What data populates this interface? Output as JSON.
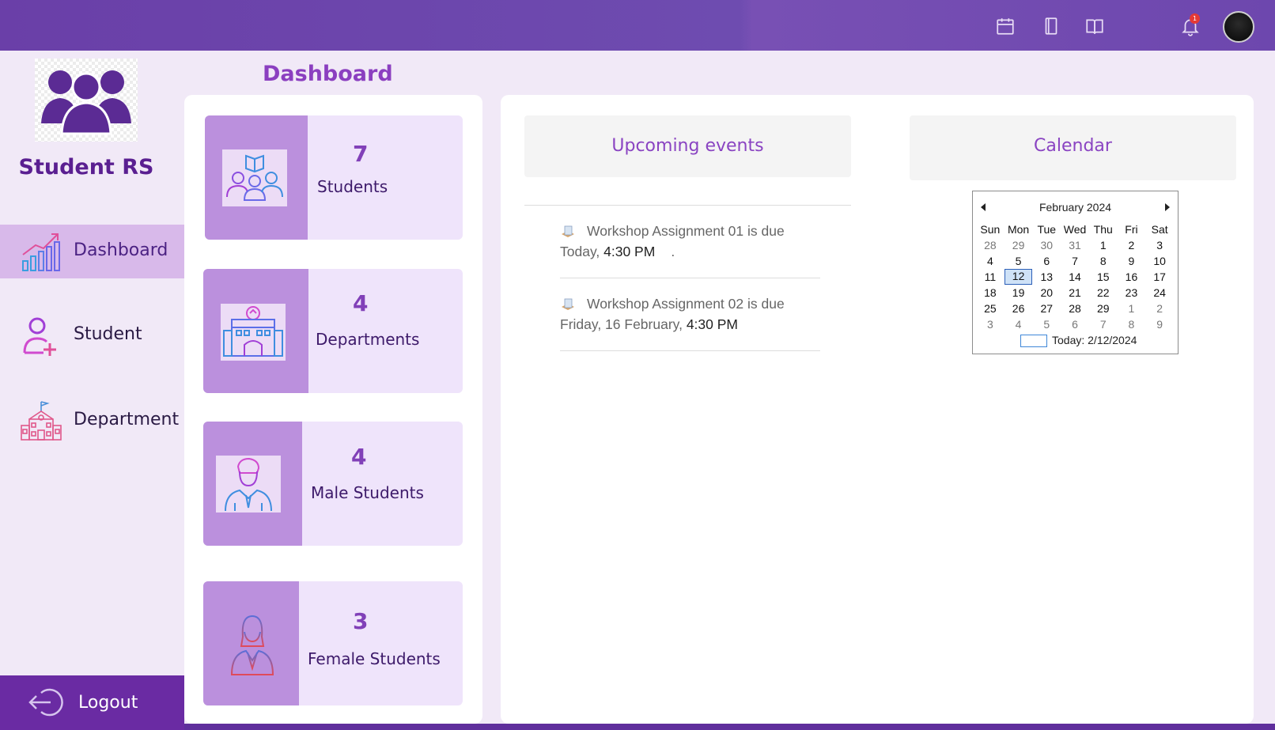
{
  "app": {
    "brand": "Student RS",
    "notification_count": "1"
  },
  "sidebar": {
    "items": [
      {
        "label": "Dashboard",
        "icon": "bar-chart-icon",
        "active": true
      },
      {
        "label": "Student",
        "icon": "add-user-icon",
        "active": false
      },
      {
        "label": "Department",
        "icon": "school-building-icon",
        "active": false
      }
    ],
    "logout_label": "Logout"
  },
  "page": {
    "title": "Dashboard"
  },
  "stats": [
    {
      "value": "7",
      "label": "Students",
      "icon": "students-reading-icon"
    },
    {
      "value": "4",
      "label": "Departments",
      "icon": "building-icon"
    },
    {
      "value": "4",
      "label": "Male Students",
      "icon": "male-student-icon"
    },
    {
      "value": "3",
      "label": "Female Students",
      "icon": "female-student-icon"
    }
  ],
  "events": {
    "title": "Upcoming events",
    "items": [
      {
        "title": "Workshop Assignment 01 is due",
        "day": "Today, ",
        "time": "4:30 PM",
        "extra": "."
      },
      {
        "title": "Workshop Assignment 02 is due",
        "day": "Friday, 16 February, ",
        "time": "4:30 PM",
        "extra": ""
      }
    ]
  },
  "calendar": {
    "title": "Calendar",
    "month": "February 2024",
    "weekdays": [
      "Sun",
      "Mon",
      "Tue",
      "Wed",
      "Thu",
      "Fri",
      "Sat"
    ],
    "weeks": [
      [
        "28",
        "29",
        "30",
        "31",
        "1",
        "2",
        "3"
      ],
      [
        "4",
        "5",
        "6",
        "7",
        "8",
        "9",
        "10"
      ],
      [
        "11",
        "12",
        "13",
        "14",
        "15",
        "16",
        "17"
      ],
      [
        "18",
        "19",
        "20",
        "21",
        "22",
        "23",
        "24"
      ],
      [
        "25",
        "26",
        "27",
        "28",
        "29",
        "1",
        "2"
      ],
      [
        "3",
        "4",
        "5",
        "6",
        "7",
        "8",
        "9"
      ]
    ],
    "selected_day": "12",
    "today_label": "Today: 2/12/2024"
  },
  "colors": {
    "topbar": "#6a3fa8",
    "accent": "#8140b8",
    "sidebar_active": "#d8b9ea",
    "logout_bg": "#6a2ba3",
    "card_bg": "#efe4fb",
    "card_icon_bg": "#bb90dd"
  }
}
